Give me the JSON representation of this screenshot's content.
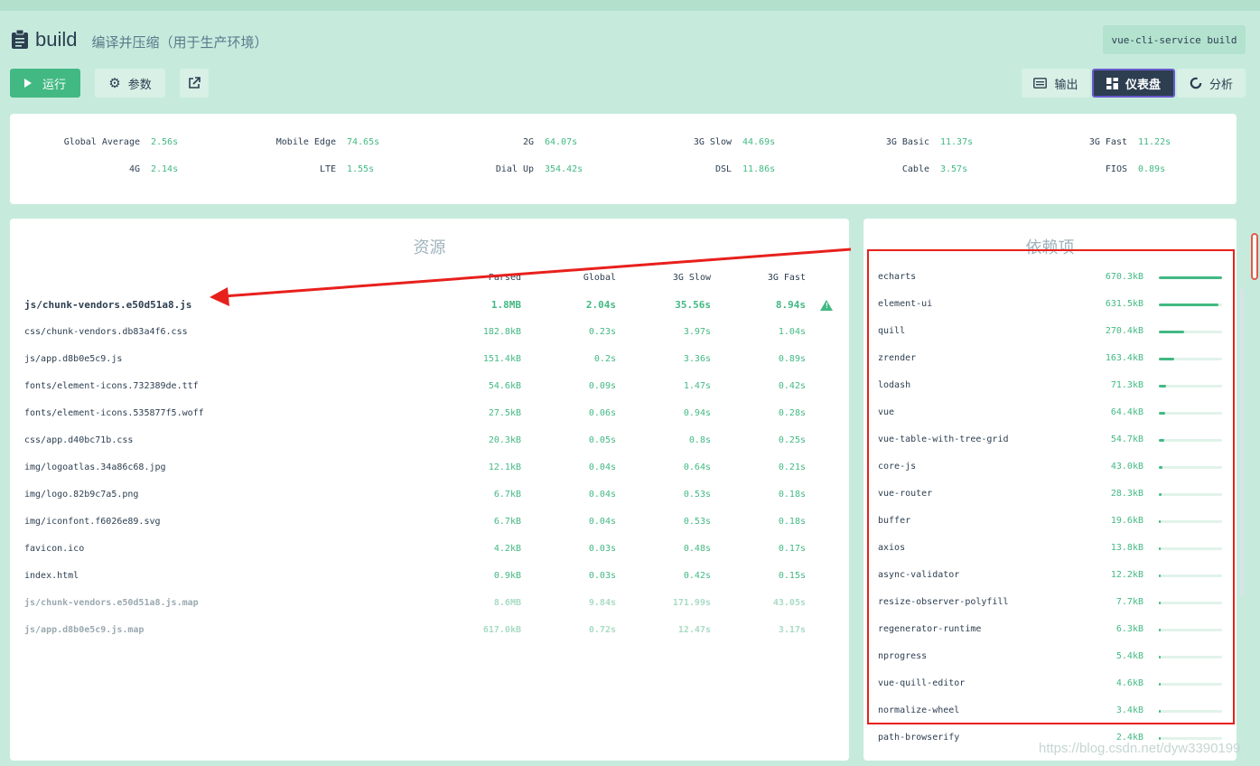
{
  "task": {
    "name": "build",
    "description": "编译并压缩（用于生产环境）",
    "command": "vue-cli-service build"
  },
  "toolbar": {
    "run_label": "运行",
    "params_label": "参数",
    "output_label": "输出",
    "dashboard_label": "仪表盘",
    "analyze_label": "分析"
  },
  "speed": {
    "row1": [
      {
        "label": "Global Average",
        "value": "2.56s"
      },
      {
        "label": "Mobile Edge",
        "value": "74.65s"
      },
      {
        "label": "2G",
        "value": "64.07s"
      },
      {
        "label": "3G Slow",
        "value": "44.69s"
      },
      {
        "label": "3G Basic",
        "value": "11.37s"
      },
      {
        "label": "3G Fast",
        "value": "11.22s"
      }
    ],
    "row2": [
      {
        "label": "4G",
        "value": "2.14s"
      },
      {
        "label": "LTE",
        "value": "1.55s"
      },
      {
        "label": "Dial Up",
        "value": "354.42s"
      },
      {
        "label": "DSL",
        "value": "11.86s"
      },
      {
        "label": "Cable",
        "value": "3.57s"
      },
      {
        "label": "FIOS",
        "value": "0.89s"
      }
    ]
  },
  "assets": {
    "title": "资源",
    "headers": [
      "Parsed",
      "Global",
      "3G Slow",
      "3G Fast"
    ],
    "rows": [
      {
        "name": "js/chunk-vendors.e50d51a8.js",
        "parsed": "1.8MB",
        "global": "2.04s",
        "slow": "35.56s",
        "fast": "8.94s"
      },
      {
        "name": "css/chunk-vendors.db83a4f6.css",
        "parsed": "182.8kB",
        "global": "0.23s",
        "slow": "3.97s",
        "fast": "1.04s"
      },
      {
        "name": "js/app.d8b0e5c9.js",
        "parsed": "151.4kB",
        "global": "0.2s",
        "slow": "3.36s",
        "fast": "0.89s"
      },
      {
        "name": "fonts/element-icons.732389de.ttf",
        "parsed": "54.6kB",
        "global": "0.09s",
        "slow": "1.47s",
        "fast": "0.42s"
      },
      {
        "name": "fonts/element-icons.535877f5.woff",
        "parsed": "27.5kB",
        "global": "0.06s",
        "slow": "0.94s",
        "fast": "0.28s"
      },
      {
        "name": "css/app.d40bc71b.css",
        "parsed": "20.3kB",
        "global": "0.05s",
        "slow": "0.8s",
        "fast": "0.25s"
      },
      {
        "name": "img/logoatlas.34a86c68.jpg",
        "parsed": "12.1kB",
        "global": "0.04s",
        "slow": "0.64s",
        "fast": "0.21s"
      },
      {
        "name": "img/logo.82b9c7a5.png",
        "parsed": "6.7kB",
        "global": "0.04s",
        "slow": "0.53s",
        "fast": "0.18s"
      },
      {
        "name": "img/iconfont.f6026e89.svg",
        "parsed": "6.7kB",
        "global": "0.04s",
        "slow": "0.53s",
        "fast": "0.18s"
      },
      {
        "name": "favicon.ico",
        "parsed": "4.2kB",
        "global": "0.03s",
        "slow": "0.48s",
        "fast": "0.17s"
      },
      {
        "name": "index.html",
        "parsed": "0.9kB",
        "global": "0.03s",
        "slow": "0.42s",
        "fast": "0.15s"
      },
      {
        "name": "js/chunk-vendors.e50d51a8.js.map",
        "parsed": "8.6MB",
        "global": "9.84s",
        "slow": "171.99s",
        "fast": "43.05s"
      },
      {
        "name": "js/app.d8b0e5c9.js.map",
        "parsed": "617.0kB",
        "global": "0.72s",
        "slow": "12.47s",
        "fast": "3.17s"
      }
    ]
  },
  "deps": {
    "title": "依赖项",
    "rows": [
      {
        "name": "echarts",
        "size": "670.3kB",
        "ratio": 1.0
      },
      {
        "name": "element-ui",
        "size": "631.5kB",
        "ratio": 0.94
      },
      {
        "name": "quill",
        "size": "270.4kB",
        "ratio": 0.4
      },
      {
        "name": "zrender",
        "size": "163.4kB",
        "ratio": 0.24
      },
      {
        "name": "lodash",
        "size": "71.3kB",
        "ratio": 0.11
      },
      {
        "name": "vue",
        "size": "64.4kB",
        "ratio": 0.1
      },
      {
        "name": "vue-table-with-tree-grid",
        "size": "54.7kB",
        "ratio": 0.08
      },
      {
        "name": "core-js",
        "size": "43.0kB",
        "ratio": 0.064
      },
      {
        "name": "vue-router",
        "size": "28.3kB",
        "ratio": 0.042
      },
      {
        "name": "buffer",
        "size": "19.6kB",
        "ratio": 0.029
      },
      {
        "name": "axios",
        "size": "13.8kB",
        "ratio": 0.021
      },
      {
        "name": "async-validator",
        "size": "12.2kB",
        "ratio": 0.018
      },
      {
        "name": "resize-observer-polyfill",
        "size": "7.7kB",
        "ratio": 0.011
      },
      {
        "name": "regenerator-runtime",
        "size": "6.3kB",
        "ratio": 0.009
      },
      {
        "name": "nprogress",
        "size": "5.4kB",
        "ratio": 0.008
      },
      {
        "name": "vue-quill-editor",
        "size": "4.6kB",
        "ratio": 0.007
      },
      {
        "name": "normalize-wheel",
        "size": "3.4kB",
        "ratio": 0.005
      },
      {
        "name": "path-browserify",
        "size": "2.4kB",
        "ratio": 0.004
      }
    ]
  },
  "watermark": "https://blog.csdn.net/dyw3390199",
  "colors": {
    "accent": "#42b983",
    "dark": "#2c3e50",
    "annotation": "#e8201c"
  }
}
